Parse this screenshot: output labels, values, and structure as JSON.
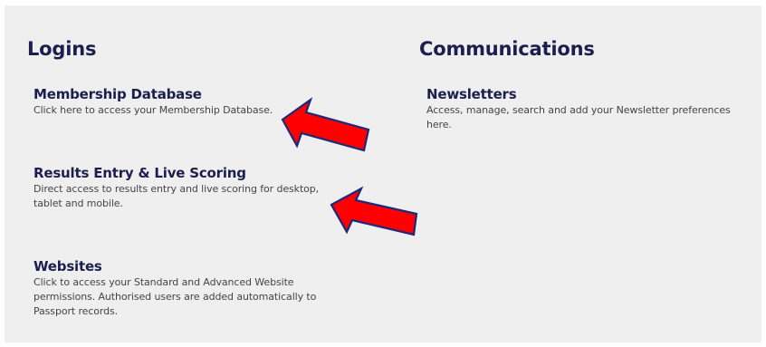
{
  "logins": {
    "heading": "Logins",
    "items": [
      {
        "title": "Membership Database",
        "description": "Click here to access your Membership Database."
      },
      {
        "title": "Results Entry & Live Scoring",
        "description": "Direct access to results entry and live scoring for desktop, tablet and mobile."
      },
      {
        "title": "Websites",
        "description": "Click to access your Standard and Advanced Website permissions. Authorised users are added automatically to Passport records."
      }
    ]
  },
  "communications": {
    "heading": "Communications",
    "items": [
      {
        "title": "Newsletters",
        "description": "Access, manage, search and add your Newsletter preferences here."
      }
    ]
  },
  "annotations": {
    "arrow_color": "#ff0000",
    "arrow_outline": "#1a2a7a"
  }
}
